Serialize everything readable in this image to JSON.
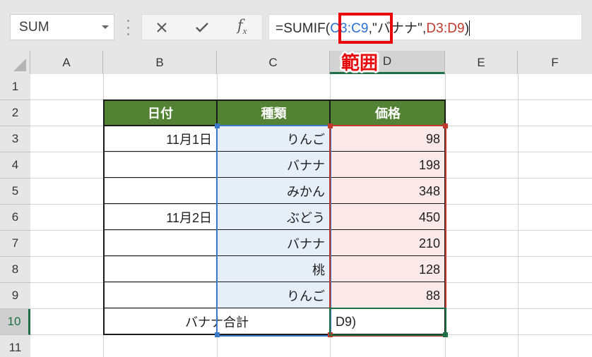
{
  "formula_bar": {
    "name_box_value": "SUM",
    "name_box_dropdown_icon": "chevron-down-icon",
    "grip_icon": "drag-grip-icon",
    "cancel_icon": "close-x-icon",
    "enter_icon": "checkmark-icon",
    "function_icon": "fx-insert-function-icon",
    "formula_full": "=SUMIF(C3:C9,\"バナナ\",D3:D9)",
    "formula_tokens": [
      {
        "text": "=SUMIF(",
        "color": "#2b2b2b"
      },
      {
        "text": "C3:C9",
        "color": "#2a6fd6"
      },
      {
        "text": ",\"バナナ\",",
        "color": "#2b2b2b"
      },
      {
        "text": "D3:D9",
        "color": "#c0392b"
      },
      {
        "text": ")",
        "color": "#2b2b2b"
      }
    ]
  },
  "annotations": {
    "formula_highlight_box": {
      "target": "C3:C9",
      "color": "#e8070a"
    },
    "column_label": {
      "text": "範囲",
      "color": "#e8070a"
    }
  },
  "sheet": {
    "column_headers": [
      {
        "label": "A",
        "active": false
      },
      {
        "label": "B",
        "active": false
      },
      {
        "label": "C",
        "active": false
      },
      {
        "label": "D",
        "active": true
      },
      {
        "label": "E",
        "active": false
      },
      {
        "label": "F",
        "active": false
      }
    ],
    "row_headers": [
      {
        "label": "1",
        "active": false
      },
      {
        "label": "2",
        "active": false
      },
      {
        "label": "3",
        "active": false
      },
      {
        "label": "4",
        "active": false
      },
      {
        "label": "5",
        "active": false
      },
      {
        "label": "6",
        "active": false
      },
      {
        "label": "7",
        "active": false
      },
      {
        "label": "8",
        "active": false
      },
      {
        "label": "9",
        "active": false
      },
      {
        "label": "10",
        "active": true
      },
      {
        "label": "11",
        "active": false
      }
    ],
    "table": {
      "header_row": {
        "b": "日付",
        "c": "種類",
        "d": "価格"
      },
      "rows": [
        {
          "row": "3",
          "b": "11月1日",
          "c": "りんご",
          "d": "98"
        },
        {
          "row": "4",
          "b": "",
          "c": "バナナ",
          "d": "198"
        },
        {
          "row": "5",
          "b": "",
          "c": "みかん",
          "d": "348"
        },
        {
          "row": "6",
          "b": "11月2日",
          "c": "ぶどう",
          "d": "450"
        },
        {
          "row": "7",
          "b": "",
          "c": "バナナ",
          "d": "210"
        },
        {
          "row": "8",
          "b": "",
          "c": "桃",
          "d": "128"
        },
        {
          "row": "9",
          "b": "",
          "c": "りんご",
          "d": "88"
        }
      ],
      "total_row": {
        "label": "バナナ合計",
        "value": "D9)"
      }
    },
    "selection": {
      "range_c": "C3:C9",
      "range_d": "D3:D9",
      "active_cell": "D10",
      "color_c": "#3b78c8",
      "color_d": "#c0392b",
      "color_active": "#1f7145"
    },
    "header_fill": "#548235"
  }
}
